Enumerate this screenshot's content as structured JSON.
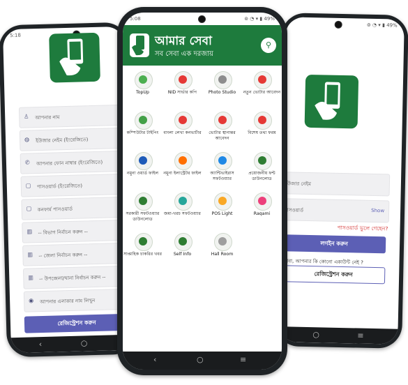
{
  "left_phone": {
    "status_time": "5:18",
    "fields": [
      {
        "icon": "user-icon",
        "text": "আপনার নাম"
      },
      {
        "icon": "user-badge-icon",
        "text": "ইউজার নেইম (ইংরেজিতে)"
      },
      {
        "icon": "phone-icon",
        "text": "আপনার ফোন নাম্বার (ইংরেজিতে)"
      },
      {
        "icon": "lock-icon",
        "text": "পাসওয়ার্ড (ইংরেজিতে)"
      },
      {
        "icon": "lock-icon",
        "text": "কনফার্ম পাসওয়ার্ড"
      },
      {
        "icon": "building-icon",
        "text": "-- বিভাগ নির্বাচন করুন --"
      },
      {
        "icon": "building-icon",
        "text": "-- জেলা নির্বাচন করুন --"
      },
      {
        "icon": "building-icon",
        "text": "-- উপজেলা/থানা নির্বাচন করুন --"
      },
      {
        "icon": "location-icon",
        "text": "আপনার এলাকার নাম লিখুন"
      }
    ],
    "register_label": "রেজিস্ট্রেশন করুন"
  },
  "center_phone": {
    "status_time": "5:08",
    "status_right": "⊚ ◔ ▾ ▮ 49%",
    "app_title": "আমার সেবা",
    "app_subtitle": "সব সেবা এক দরজায়",
    "items": [
      {
        "label": "TopUp",
        "color": "#4caf50"
      },
      {
        "label": "NID সার্ভার কপি",
        "color": "#e53935"
      },
      {
        "label": "Photo Studio",
        "color": "#8d8d8d"
      },
      {
        "label": "নতুন ভোটার আবেদন",
        "color": "#e53935"
      },
      {
        "label": "কম্পিউটার টাইপিং",
        "color": "#43a047"
      },
      {
        "label": "বাংলা লেখা কনভার্টার",
        "color": "#e53935"
      },
      {
        "label": "ভোটার স্থানান্তর আবেদন",
        "color": "#e53935"
      },
      {
        "label": "বিশেষ তথ্য ফরম",
        "color": "#e53935"
      },
      {
        "label": "নমুনা ওয়ার্ড ফাইল",
        "color": "#1e5bb8"
      },
      {
        "label": "নমুনা ইলাস্ট্রেটর ফাইল",
        "color": "#ff6f00"
      },
      {
        "label": "অ্যান্টিভাইরাস সফটওয়্যার",
        "color": "#1e88e5"
      },
      {
        "label": "প্রয়োজনীয় ফন্ট ডাউনলোড",
        "color": "#2e7d32"
      },
      {
        "label": "সরকারী সফটওয়্যার ডাউনলোড",
        "color": "#2e7d32"
      },
      {
        "label": "জমা-খরচ সফটওয়্যার",
        "color": "#26a69a"
      },
      {
        "label": "POS Light",
        "color": "#f9a825"
      },
      {
        "label": "Raqami",
        "color": "#ec407a"
      },
      {
        "label": "সাপ্তাহিক চাকরির খবর",
        "color": "#2e7d32"
      },
      {
        "label": "Self Info",
        "color": "#2e7d32"
      },
      {
        "label": "Hall Room",
        "color": "#9e9e9e"
      }
    ]
  },
  "right_phone": {
    "status_right": "⊚ ◔ ▾ ▮ 49%",
    "username_placeholder": "ইউজার নেইম",
    "password_placeholder": "পাসওয়ার্ড",
    "show_label": "Show",
    "forgot_label": "পাসওয়ার্ড ভুলে গেছেন?",
    "login_label": "লগইন করুন",
    "no_account_label": "অথবা, আপনার কি কোনো একাউন্ট নেই ?",
    "register_label": "রেজিস্ট্রেশন করুন"
  },
  "nav": {
    "back": "‹",
    "home": "○",
    "menu": "≡"
  },
  "colors": {
    "brand_green": "#1e7b3d",
    "accent_purple": "#5c5fb5",
    "forgot_red": "#d32f2f"
  }
}
